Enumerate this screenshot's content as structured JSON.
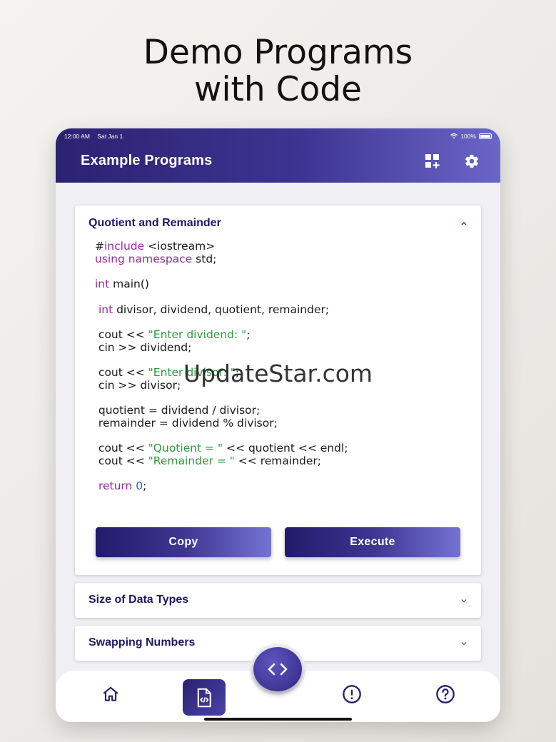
{
  "headline": {
    "line1": "Demo Programs",
    "line2": "with Code"
  },
  "status_bar": {
    "time": "12:00 AM",
    "date": "Sat Jan 1",
    "battery": "100%"
  },
  "app_bar": {
    "title": "Example Programs",
    "icons": [
      "add-widget-icon",
      "settings-gear-icon"
    ]
  },
  "expanded_card": {
    "title": "Quotient and Remainder",
    "code_lines": [
      [
        {
          "t": "#"
        },
        {
          "t": "include",
          "c": "kw"
        },
        {
          "t": " <iostream>"
        }
      ],
      [
        {
          "t": "using namespace",
          "c": "kw"
        },
        {
          "t": " std;"
        }
      ],
      [
        {
          "t": "int",
          "c": "kw"
        },
        {
          "t": " main()"
        }
      ],
      [
        {
          "t": " "
        },
        {
          "t": "int",
          "c": "kw"
        },
        {
          "t": " divisor, dividend, quotient, remainder;"
        }
      ],
      [
        {
          "t": " cout << "
        },
        {
          "t": "\"Enter dividend: \"",
          "c": "str"
        },
        {
          "t": ";"
        }
      ],
      [
        {
          "t": " cin >> dividend;"
        }
      ],
      [
        {
          "t": " cout << "
        },
        {
          "t": "\"Enter divisor: \"",
          "c": "str"
        },
        {
          "t": ";"
        }
      ],
      [
        {
          "t": " cin >> divisor;"
        }
      ],
      [
        {
          "t": " quotient = dividend / divisor;"
        }
      ],
      [
        {
          "t": " remainder = dividend % divisor;"
        }
      ],
      [
        {
          "t": " cout << "
        },
        {
          "t": "\"Quotient = \"",
          "c": "str"
        },
        {
          "t": " << quotient << endl;"
        }
      ],
      [
        {
          "t": " cout << "
        },
        {
          "t": "\"Remainder = \"",
          "c": "str"
        },
        {
          "t": " << remainder;"
        }
      ],
      [
        {
          "t": " "
        },
        {
          "t": "return",
          "c": "kw"
        },
        {
          "t": " "
        },
        {
          "t": "0",
          "c": "num"
        },
        {
          "t": ";"
        }
      ]
    ],
    "copy_label": "Copy",
    "execute_label": "Execute"
  },
  "collapsed_cards": [
    {
      "title": "Size of Data Types"
    },
    {
      "title": "Swapping Numbers"
    }
  ],
  "watermark": "UpdateStar.com",
  "bottom_nav": {
    "items": [
      "home-icon",
      "code-file-icon",
      "code-brackets-icon",
      "alert-icon",
      "help-icon"
    ],
    "active": "code-file-icon"
  },
  "colors": {
    "primary": "#2c2272",
    "accent": "#6a66c8",
    "keyword": "#9a2aa0",
    "string": "#2a9d3c",
    "number": "#2567c4"
  }
}
